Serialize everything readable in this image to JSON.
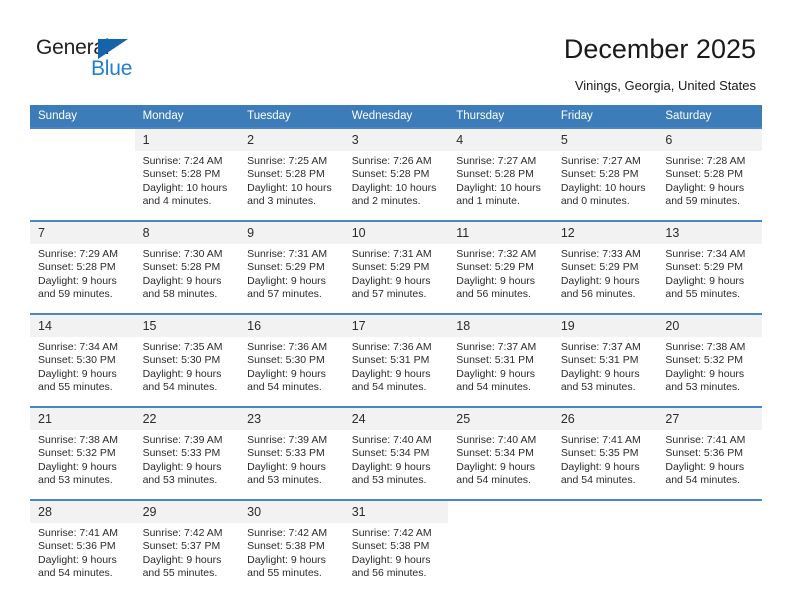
{
  "logo": {
    "word_top": "General",
    "word_bottom": "Blue",
    "accent_color": "#1464aa",
    "blue_text_color": "#1f7fd1"
  },
  "header": {
    "title": "December 2025",
    "subtitle": "Vinings, Georgia, United States"
  },
  "theme": {
    "header_row_bg": "#3b7cb9",
    "row_divider": "#4a86c5",
    "daynum_bg": "#f2f2f2",
    "text": "#2b2b2b"
  },
  "calendar": {
    "weekday_headers": [
      "Sunday",
      "Monday",
      "Tuesday",
      "Wednesday",
      "Thursday",
      "Friday",
      "Saturday"
    ],
    "labels": {
      "sunrise": "Sunrise:",
      "sunset": "Sunset:",
      "daylight": "Daylight:"
    },
    "weeks": [
      [
        {
          "day": "",
          "sunrise": "",
          "sunset": "",
          "daylight_1": "",
          "daylight_2": ""
        },
        {
          "day": "1",
          "sunrise": "Sunrise: 7:24 AM",
          "sunset": "Sunset: 5:28 PM",
          "daylight_1": "Daylight: 10 hours",
          "daylight_2": "and 4 minutes."
        },
        {
          "day": "2",
          "sunrise": "Sunrise: 7:25 AM",
          "sunset": "Sunset: 5:28 PM",
          "daylight_1": "Daylight: 10 hours",
          "daylight_2": "and 3 minutes."
        },
        {
          "day": "3",
          "sunrise": "Sunrise: 7:26 AM",
          "sunset": "Sunset: 5:28 PM",
          "daylight_1": "Daylight: 10 hours",
          "daylight_2": "and 2 minutes."
        },
        {
          "day": "4",
          "sunrise": "Sunrise: 7:27 AM",
          "sunset": "Sunset: 5:28 PM",
          "daylight_1": "Daylight: 10 hours",
          "daylight_2": "and 1 minute."
        },
        {
          "day": "5",
          "sunrise": "Sunrise: 7:27 AM",
          "sunset": "Sunset: 5:28 PM",
          "daylight_1": "Daylight: 10 hours",
          "daylight_2": "and 0 minutes."
        },
        {
          "day": "6",
          "sunrise": "Sunrise: 7:28 AM",
          "sunset": "Sunset: 5:28 PM",
          "daylight_1": "Daylight: 9 hours",
          "daylight_2": "and 59 minutes."
        }
      ],
      [
        {
          "day": "7",
          "sunrise": "Sunrise: 7:29 AM",
          "sunset": "Sunset: 5:28 PM",
          "daylight_1": "Daylight: 9 hours",
          "daylight_2": "and 59 minutes."
        },
        {
          "day": "8",
          "sunrise": "Sunrise: 7:30 AM",
          "sunset": "Sunset: 5:28 PM",
          "daylight_1": "Daylight: 9 hours",
          "daylight_2": "and 58 minutes."
        },
        {
          "day": "9",
          "sunrise": "Sunrise: 7:31 AM",
          "sunset": "Sunset: 5:29 PM",
          "daylight_1": "Daylight: 9 hours",
          "daylight_2": "and 57 minutes."
        },
        {
          "day": "10",
          "sunrise": "Sunrise: 7:31 AM",
          "sunset": "Sunset: 5:29 PM",
          "daylight_1": "Daylight: 9 hours",
          "daylight_2": "and 57 minutes."
        },
        {
          "day": "11",
          "sunrise": "Sunrise: 7:32 AM",
          "sunset": "Sunset: 5:29 PM",
          "daylight_1": "Daylight: 9 hours",
          "daylight_2": "and 56 minutes."
        },
        {
          "day": "12",
          "sunrise": "Sunrise: 7:33 AM",
          "sunset": "Sunset: 5:29 PM",
          "daylight_1": "Daylight: 9 hours",
          "daylight_2": "and 56 minutes."
        },
        {
          "day": "13",
          "sunrise": "Sunrise: 7:34 AM",
          "sunset": "Sunset: 5:29 PM",
          "daylight_1": "Daylight: 9 hours",
          "daylight_2": "and 55 minutes."
        }
      ],
      [
        {
          "day": "14",
          "sunrise": "Sunrise: 7:34 AM",
          "sunset": "Sunset: 5:30 PM",
          "daylight_1": "Daylight: 9 hours",
          "daylight_2": "and 55 minutes."
        },
        {
          "day": "15",
          "sunrise": "Sunrise: 7:35 AM",
          "sunset": "Sunset: 5:30 PM",
          "daylight_1": "Daylight: 9 hours",
          "daylight_2": "and 54 minutes."
        },
        {
          "day": "16",
          "sunrise": "Sunrise: 7:36 AM",
          "sunset": "Sunset: 5:30 PM",
          "daylight_1": "Daylight: 9 hours",
          "daylight_2": "and 54 minutes."
        },
        {
          "day": "17",
          "sunrise": "Sunrise: 7:36 AM",
          "sunset": "Sunset: 5:31 PM",
          "daylight_1": "Daylight: 9 hours",
          "daylight_2": "and 54 minutes."
        },
        {
          "day": "18",
          "sunrise": "Sunrise: 7:37 AM",
          "sunset": "Sunset: 5:31 PM",
          "daylight_1": "Daylight: 9 hours",
          "daylight_2": "and 54 minutes."
        },
        {
          "day": "19",
          "sunrise": "Sunrise: 7:37 AM",
          "sunset": "Sunset: 5:31 PM",
          "daylight_1": "Daylight: 9 hours",
          "daylight_2": "and 53 minutes."
        },
        {
          "day": "20",
          "sunrise": "Sunrise: 7:38 AM",
          "sunset": "Sunset: 5:32 PM",
          "daylight_1": "Daylight: 9 hours",
          "daylight_2": "and 53 minutes."
        }
      ],
      [
        {
          "day": "21",
          "sunrise": "Sunrise: 7:38 AM",
          "sunset": "Sunset: 5:32 PM",
          "daylight_1": "Daylight: 9 hours",
          "daylight_2": "and 53 minutes."
        },
        {
          "day": "22",
          "sunrise": "Sunrise: 7:39 AM",
          "sunset": "Sunset: 5:33 PM",
          "daylight_1": "Daylight: 9 hours",
          "daylight_2": "and 53 minutes."
        },
        {
          "day": "23",
          "sunrise": "Sunrise: 7:39 AM",
          "sunset": "Sunset: 5:33 PM",
          "daylight_1": "Daylight: 9 hours",
          "daylight_2": "and 53 minutes."
        },
        {
          "day": "24",
          "sunrise": "Sunrise: 7:40 AM",
          "sunset": "Sunset: 5:34 PM",
          "daylight_1": "Daylight: 9 hours",
          "daylight_2": "and 53 minutes."
        },
        {
          "day": "25",
          "sunrise": "Sunrise: 7:40 AM",
          "sunset": "Sunset: 5:34 PM",
          "daylight_1": "Daylight: 9 hours",
          "daylight_2": "and 54 minutes."
        },
        {
          "day": "26",
          "sunrise": "Sunrise: 7:41 AM",
          "sunset": "Sunset: 5:35 PM",
          "daylight_1": "Daylight: 9 hours",
          "daylight_2": "and 54 minutes."
        },
        {
          "day": "27",
          "sunrise": "Sunrise: 7:41 AM",
          "sunset": "Sunset: 5:36 PM",
          "daylight_1": "Daylight: 9 hours",
          "daylight_2": "and 54 minutes."
        }
      ],
      [
        {
          "day": "28",
          "sunrise": "Sunrise: 7:41 AM",
          "sunset": "Sunset: 5:36 PM",
          "daylight_1": "Daylight: 9 hours",
          "daylight_2": "and 54 minutes."
        },
        {
          "day": "29",
          "sunrise": "Sunrise: 7:42 AM",
          "sunset": "Sunset: 5:37 PM",
          "daylight_1": "Daylight: 9 hours",
          "daylight_2": "and 55 minutes."
        },
        {
          "day": "30",
          "sunrise": "Sunrise: 7:42 AM",
          "sunset": "Sunset: 5:38 PM",
          "daylight_1": "Daylight: 9 hours",
          "daylight_2": "and 55 minutes."
        },
        {
          "day": "31",
          "sunrise": "Sunrise: 7:42 AM",
          "sunset": "Sunset: 5:38 PM",
          "daylight_1": "Daylight: 9 hours",
          "daylight_2": "and 56 minutes."
        },
        {
          "day": "",
          "sunrise": "",
          "sunset": "",
          "daylight_1": "",
          "daylight_2": ""
        },
        {
          "day": "",
          "sunrise": "",
          "sunset": "",
          "daylight_1": "",
          "daylight_2": ""
        },
        {
          "day": "",
          "sunrise": "",
          "sunset": "",
          "daylight_1": "",
          "daylight_2": ""
        }
      ]
    ]
  }
}
